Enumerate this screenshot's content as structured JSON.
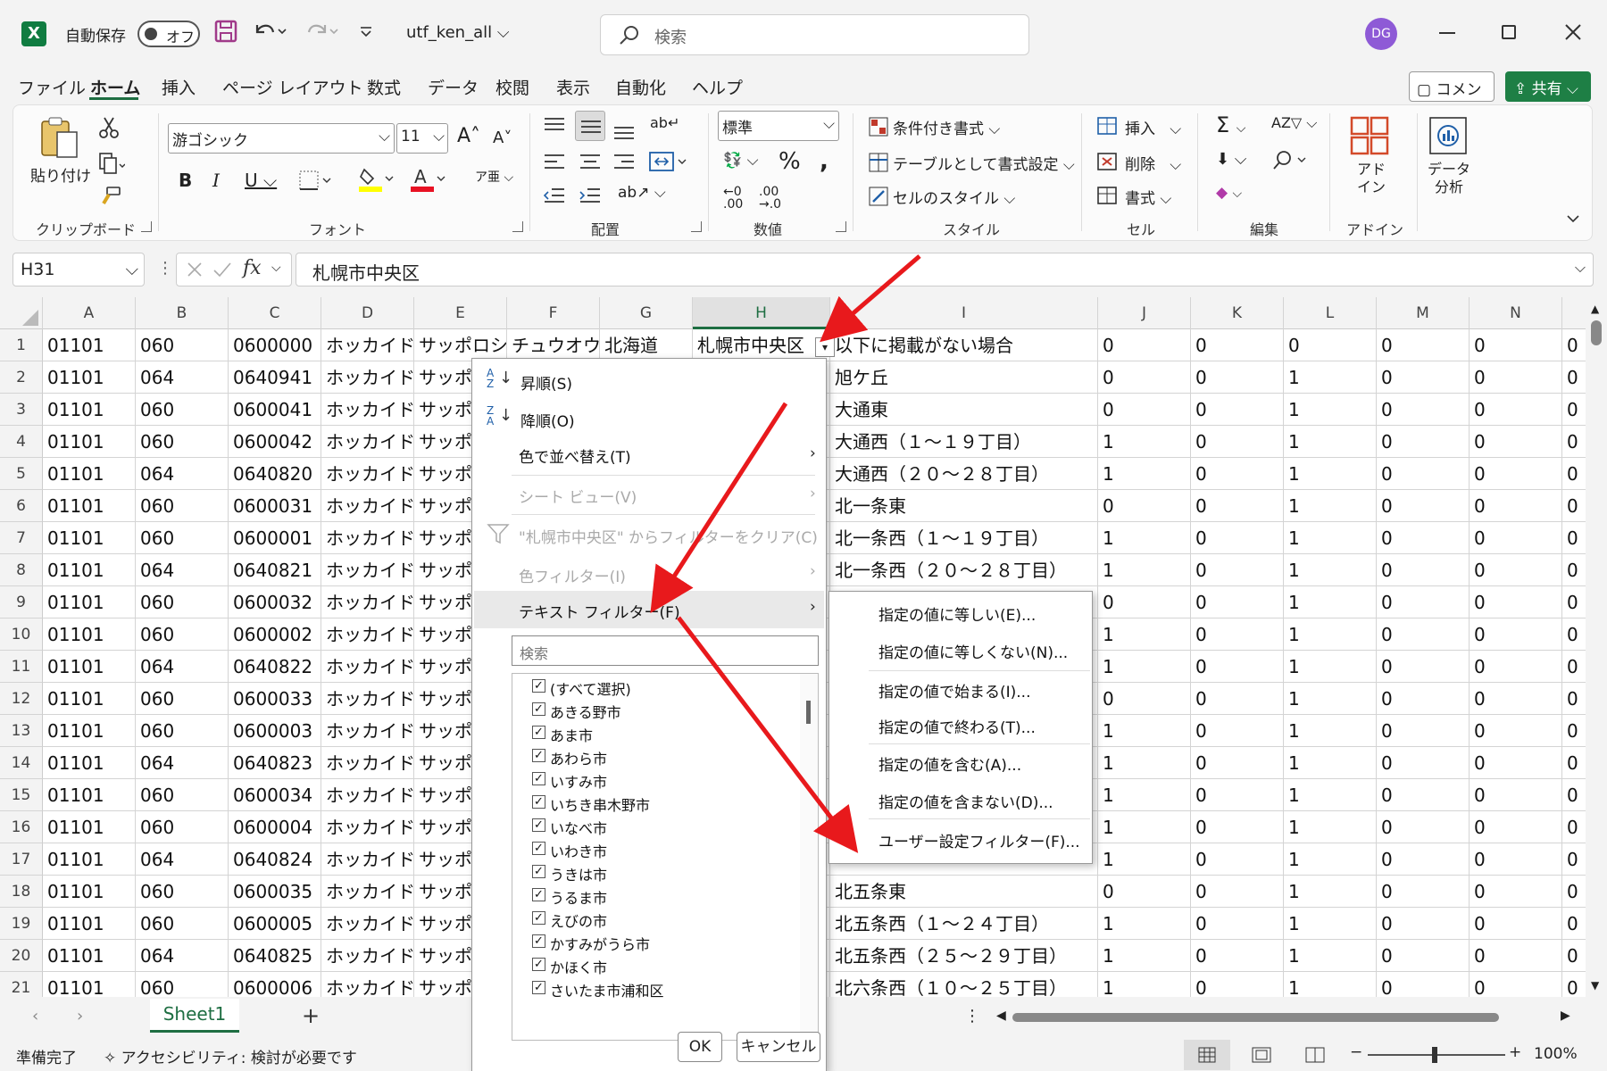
{
  "title_bar": {
    "autosave_label": "自動保存",
    "autosave_state": "オフ",
    "filename": "utf_ken_all",
    "search_placeholder": "検索",
    "avatar_initials": "DG"
  },
  "menu_tabs": [
    "ファイル",
    "ホーム",
    "挿入",
    "ページ レイアウト",
    "数式",
    "データ",
    "校閲",
    "表示",
    "自動化",
    "ヘルプ"
  ],
  "comment_label": "コメント",
  "share_label": "共有",
  "ribbon": {
    "paste_label": "貼り付け",
    "clipboard_group": "クリップボード",
    "font_name": "游ゴシック",
    "font_size": "11",
    "font_group": "フォント",
    "align_group": "配置",
    "number_format": "標準",
    "number_group": "数値",
    "conditional_format": "条件付き書式",
    "format_as_table": "テーブルとして書式設定",
    "cell_styles": "セルのスタイル",
    "style_group": "スタイル",
    "insert": "挿入",
    "delete": "削除",
    "format": "書式",
    "cells_group": "セル",
    "edit_group": "編集",
    "addins_label": "アド イン",
    "addins_group": "アドイン",
    "data_analysis": "データ 分析"
  },
  "formula_bar": {
    "name_box": "H31",
    "content": "札幌市中央区"
  },
  "columns": [
    "A",
    "B",
    "C",
    "D",
    "E",
    "F",
    "G",
    "H",
    "I",
    "J",
    "K",
    "L",
    "M",
    "N"
  ],
  "rows": [
    [
      "1",
      "01101",
      "060",
      "0600000",
      "ホッカイド",
      "サッポロシ",
      "チュウオウク",
      "北海道",
      "札幌市中央区",
      "以下に掲載がない場合",
      "0",
      "0",
      "0",
      "0",
      "0",
      "0"
    ],
    [
      "2",
      "01101",
      "064",
      "0640941",
      "ホッカイド",
      "サッポロシ",
      "",
      "",
      "",
      "旭ケ丘",
      "0",
      "0",
      "1",
      "0",
      "0",
      "0"
    ],
    [
      "3",
      "01101",
      "060",
      "0600041",
      "ホッカイド",
      "サッポロシ",
      "",
      "",
      "",
      "大通東",
      "0",
      "0",
      "1",
      "0",
      "0",
      "0"
    ],
    [
      "4",
      "01101",
      "060",
      "0600042",
      "ホッカイド",
      "サッポロシ",
      "",
      "",
      "",
      "大通西（１～１９丁目）",
      "1",
      "0",
      "1",
      "0",
      "0",
      "0"
    ],
    [
      "5",
      "01101",
      "064",
      "0640820",
      "ホッカイド",
      "サッポロシ",
      "",
      "",
      "",
      "大通西（２０～２８丁目）",
      "1",
      "0",
      "1",
      "0",
      "0",
      "0"
    ],
    [
      "6",
      "01101",
      "060",
      "0600031",
      "ホッカイド",
      "サッポロシ",
      "",
      "",
      "",
      "北一条東",
      "0",
      "0",
      "1",
      "0",
      "0",
      "0"
    ],
    [
      "7",
      "01101",
      "060",
      "0600001",
      "ホッカイド",
      "サッポロシ",
      "",
      "",
      "",
      "北一条西（１～１９丁目）",
      "1",
      "0",
      "1",
      "0",
      "0",
      "0"
    ],
    [
      "8",
      "01101",
      "064",
      "0640821",
      "ホッカイド",
      "サッポロシ",
      "",
      "",
      "",
      "北一条西（２０～２８丁目）",
      "1",
      "0",
      "1",
      "0",
      "0",
      "0"
    ],
    [
      "9",
      "01101",
      "060",
      "0600032",
      "ホッカイド",
      "サッポロシ",
      "",
      "",
      "",
      "",
      "0",
      "0",
      "1",
      "0",
      "0",
      "0"
    ],
    [
      "10",
      "01101",
      "060",
      "0600002",
      "ホッカイド",
      "サッポロシ",
      "",
      "",
      "",
      "",
      "1",
      "0",
      "1",
      "0",
      "0",
      "0"
    ],
    [
      "11",
      "01101",
      "064",
      "0640822",
      "ホッカイド",
      "サッポロシ",
      "",
      "",
      "",
      "",
      "1",
      "0",
      "1",
      "0",
      "0",
      "0"
    ],
    [
      "12",
      "01101",
      "060",
      "0600033",
      "ホッカイド",
      "サッポロシ",
      "",
      "",
      "",
      "",
      "0",
      "0",
      "1",
      "0",
      "0",
      "0"
    ],
    [
      "13",
      "01101",
      "060",
      "0600003",
      "ホッカイド",
      "サッポロシ",
      "",
      "",
      "",
      "",
      "1",
      "0",
      "1",
      "0",
      "0",
      "0"
    ],
    [
      "14",
      "01101",
      "064",
      "0640823",
      "ホッカイド",
      "サッポロシ",
      "",
      "",
      "",
      "",
      "1",
      "0",
      "1",
      "0",
      "0",
      "0"
    ],
    [
      "15",
      "01101",
      "060",
      "0600034",
      "ホッカイド",
      "サッポロシ",
      "",
      "",
      "",
      "",
      "1",
      "0",
      "1",
      "0",
      "0",
      "0"
    ],
    [
      "16",
      "01101",
      "060",
      "0600004",
      "ホッカイド",
      "サッポロシ",
      "",
      "",
      "",
      "",
      "1",
      "0",
      "1",
      "0",
      "0",
      "0"
    ],
    [
      "17",
      "01101",
      "064",
      "0640824",
      "ホッカイド",
      "サッポロシ",
      "",
      "",
      "",
      "",
      "1",
      "0",
      "1",
      "0",
      "0",
      "0"
    ],
    [
      "18",
      "01101",
      "060",
      "0600035",
      "ホッカイド",
      "サッポロシ",
      "",
      "",
      "",
      "北五条東",
      "0",
      "0",
      "1",
      "0",
      "0",
      "0"
    ],
    [
      "19",
      "01101",
      "060",
      "0600005",
      "ホッカイド",
      "サッポロシ",
      "",
      "",
      "",
      "北五条西（１～２４丁目）",
      "1",
      "0",
      "1",
      "0",
      "0",
      "0"
    ],
    [
      "20",
      "01101",
      "064",
      "0640825",
      "ホッカイド",
      "サッポロシ",
      "",
      "",
      "",
      "北五条西（２５～２９丁目）",
      "1",
      "0",
      "1",
      "0",
      "0",
      "0"
    ],
    [
      "21",
      "01101",
      "060",
      "0600006",
      "ホッカイド",
      "サッポロシ",
      "",
      "",
      "",
      "北六条西（１０～２５丁目）",
      "1",
      "0",
      "1",
      "0",
      "0",
      "0"
    ]
  ],
  "filter_menu": {
    "sort_asc": "昇順(S)",
    "sort_desc": "降順(O)",
    "sort_by_color": "色で並べ替え(T)",
    "sheet_view": "シート ビュー(V)",
    "clear_filter": "\"札幌市中央区\" からフィルターをクリア(C)",
    "color_filter": "色フィルター(I)",
    "text_filter": "テキスト フィルター(F)",
    "search_placeholder": "検索",
    "values": [
      "(すべて選択)",
      "あきる野市",
      "あま市",
      "あわら市",
      "いすみ市",
      "いちき串木野市",
      "いなべ市",
      "いわき市",
      "うきは市",
      "うるま市",
      "えびの市",
      "かすみがうら市",
      "かほく市",
      "さいたま市浦和区"
    ],
    "ok": "OK",
    "cancel": "キャンセル"
  },
  "text_filter_submenu": [
    "指定の値に等しい(E)...",
    "指定の値に等しくない(N)...",
    "指定の値で始まる(I)...",
    "指定の値で終わる(T)...",
    "指定の値を含む(A)...",
    "指定の値を含まない(D)...",
    "ユーザー設定フィルター(F)..."
  ],
  "sheet_tab": "Sheet1",
  "status": {
    "ready": "準備完了",
    "accessibility": "アクセシビリティ: 検討が必要です",
    "zoom": "100%"
  },
  "colors": {
    "excel_green": "#1e6e42",
    "arrow_red": "#e8191c"
  }
}
